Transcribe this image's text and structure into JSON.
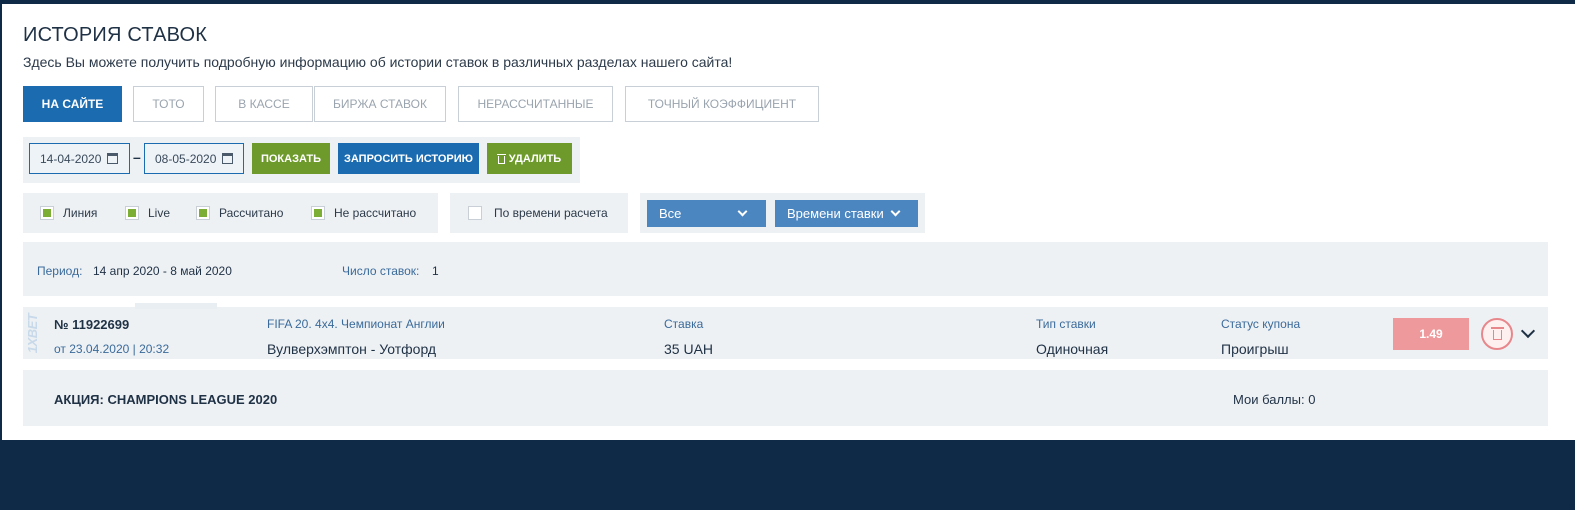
{
  "header": {
    "title": "ИСТОРИЯ СТАВОК",
    "subtitle": "Здесь Вы можете получить подробную информацию об истории ставок в различных разделах нашего сайта!"
  },
  "tabs": [
    {
      "label": "НА САЙТЕ",
      "active": true
    },
    {
      "label": "ТОТО",
      "active": false
    },
    {
      "label": "В КАССЕ",
      "active": false
    },
    {
      "label": "БИРЖА СТАВОК",
      "active": false
    },
    {
      "label": "НЕРАССЧИТАННЫЕ",
      "active": false
    },
    {
      "label": "ТОЧНЫЙ КОЭФФИЦИЕНТ",
      "active": false
    }
  ],
  "filters": {
    "date_from": "14-04-2020",
    "date_to": "08-05-2020",
    "separator": "–",
    "show_label": "ПОКАЗАТЬ",
    "request_label": "ЗАПРОСИТЬ ИСТОРИЮ",
    "delete_label": "УДАЛИТЬ"
  },
  "checkboxes": [
    {
      "label": "Линия",
      "checked": true
    },
    {
      "label": "Live",
      "checked": true
    },
    {
      "label": "Рассчитано",
      "checked": true
    },
    {
      "label": "Не рассчитано",
      "checked": true
    }
  ],
  "settle_time": {
    "label": "По времени расчета",
    "checked": false
  },
  "selects": {
    "scope": "Все",
    "sort": "Времени ставки"
  },
  "summary": {
    "period_label": "Период:",
    "period_value": "14 апр 2020 - 8 май 2020",
    "count_label": "Число ставок:",
    "count_value": "1"
  },
  "bet": {
    "logo": "1XBET",
    "number": "№ 11922699",
    "date": "от 23.04.2020 | 20:32",
    "event_header": "FIFA 20. 4x4. Чемпионат Англии",
    "event_value": "Вулверхэмптон - Уотфорд",
    "stake_header": "Ставка",
    "stake_value": "35 UAH",
    "type_header": "Тип ставки",
    "type_value": "Одиночная",
    "status_header": "Статус купона",
    "status_value": "Проигрыш",
    "coefficient": "1.49"
  },
  "promo": {
    "title": "АКЦИЯ: CHAMPIONS LEAGUE 2020",
    "points": "Мои баллы: 0"
  },
  "colors": {
    "primary": "#1b6bb0",
    "green": "#6e9a2c",
    "lost": "#ee9a9c",
    "background": "#0f2a47",
    "panel": "#eef1f4"
  }
}
